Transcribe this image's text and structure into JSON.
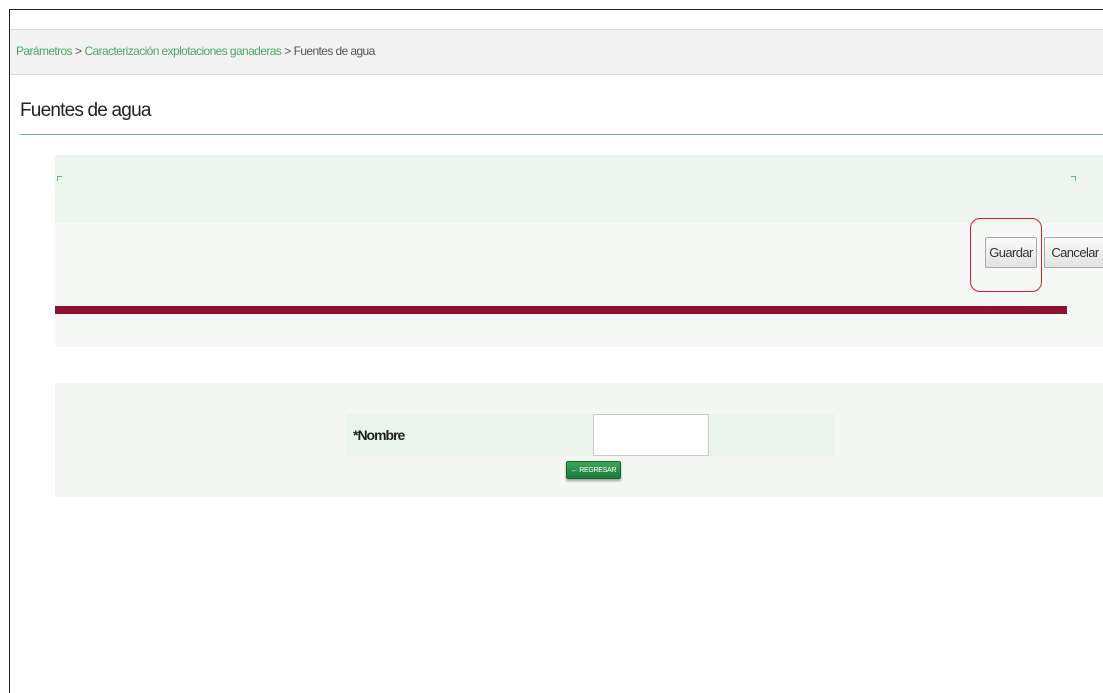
{
  "breadcrumb": {
    "items": [
      {
        "label": "Parámetros"
      },
      {
        "label": "Caracterización explotaciones ganaderas"
      },
      {
        "label": "Fuentes de agua"
      }
    ],
    "separator": ">"
  },
  "page": {
    "title": "Fuentes de agua"
  },
  "toolbar": {
    "save_label": "Guardar",
    "cancel_label": "Cancelar"
  },
  "form": {
    "name_label": "*Nombre",
    "name_value": "",
    "back_label": "← REGRESAR"
  },
  "colors": {
    "accent_green": "#4aa86a",
    "divider_maroon": "#8f1230",
    "highlight_red": "#d2232a",
    "back_button_green": "#1d7a3b"
  }
}
